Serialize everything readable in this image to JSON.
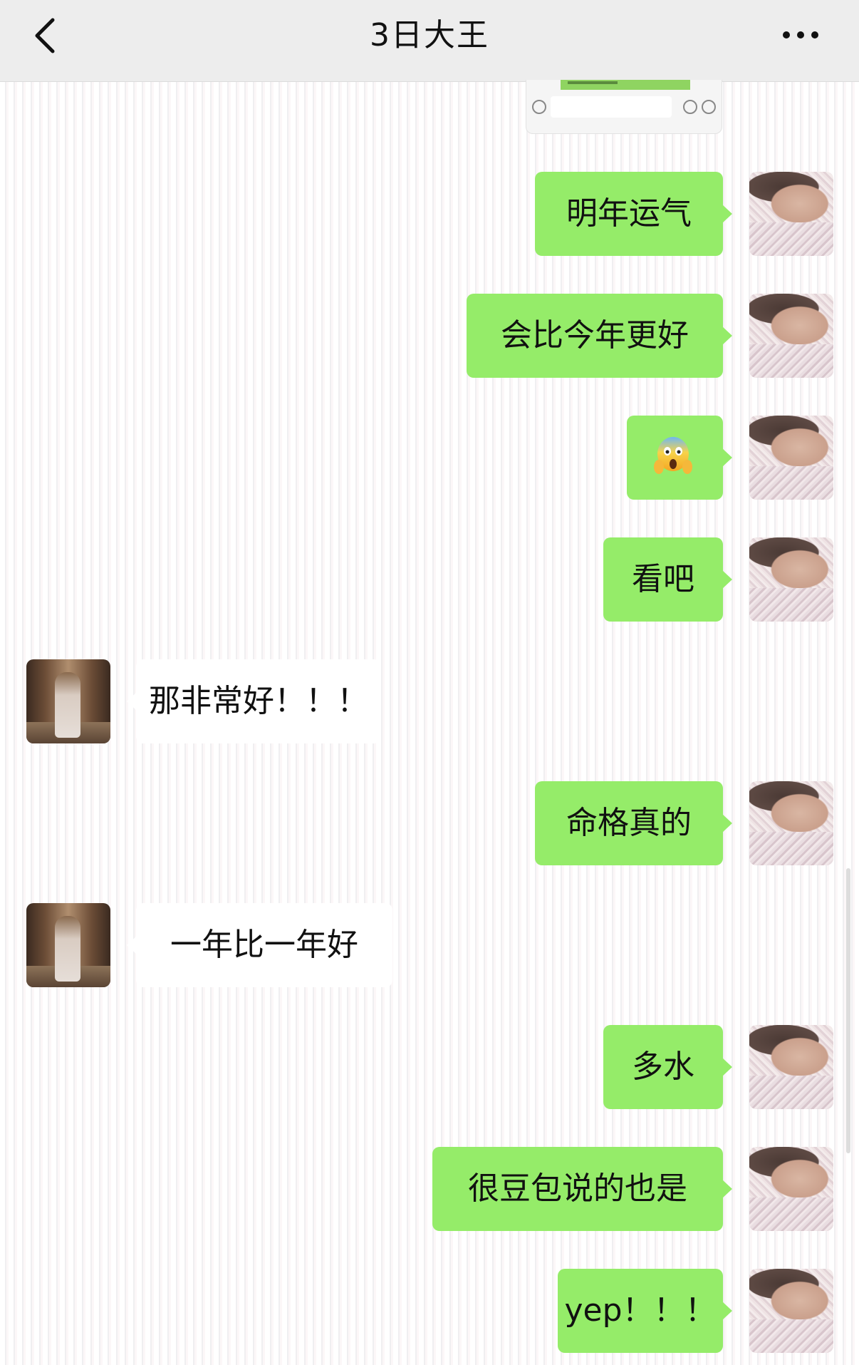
{
  "header": {
    "title": "3日大王",
    "back_icon": "chevron-left-icon",
    "more_icon": "more-dots-icon"
  },
  "messages": [
    {
      "sender": "me",
      "text": "明年运气"
    },
    {
      "sender": "me",
      "text": "会比今年更好"
    },
    {
      "sender": "me",
      "emoji": "face-screaming-in-fear",
      "text": ""
    },
    {
      "sender": "me",
      "text": "看吧"
    },
    {
      "sender": "friend",
      "text": "那非常好！！！"
    },
    {
      "sender": "me",
      "text": "命格真的"
    },
    {
      "sender": "friend",
      "text": "一年比一年好"
    },
    {
      "sender": "me",
      "text": "多水"
    },
    {
      "sender": "me",
      "text": "很豆包说的也是"
    },
    {
      "sender": "me",
      "text": "yep！！！"
    }
  ],
  "colors": {
    "my_bubble": "#95ec69",
    "friend_bubble": "#ffffff",
    "navbar": "#ededed"
  }
}
